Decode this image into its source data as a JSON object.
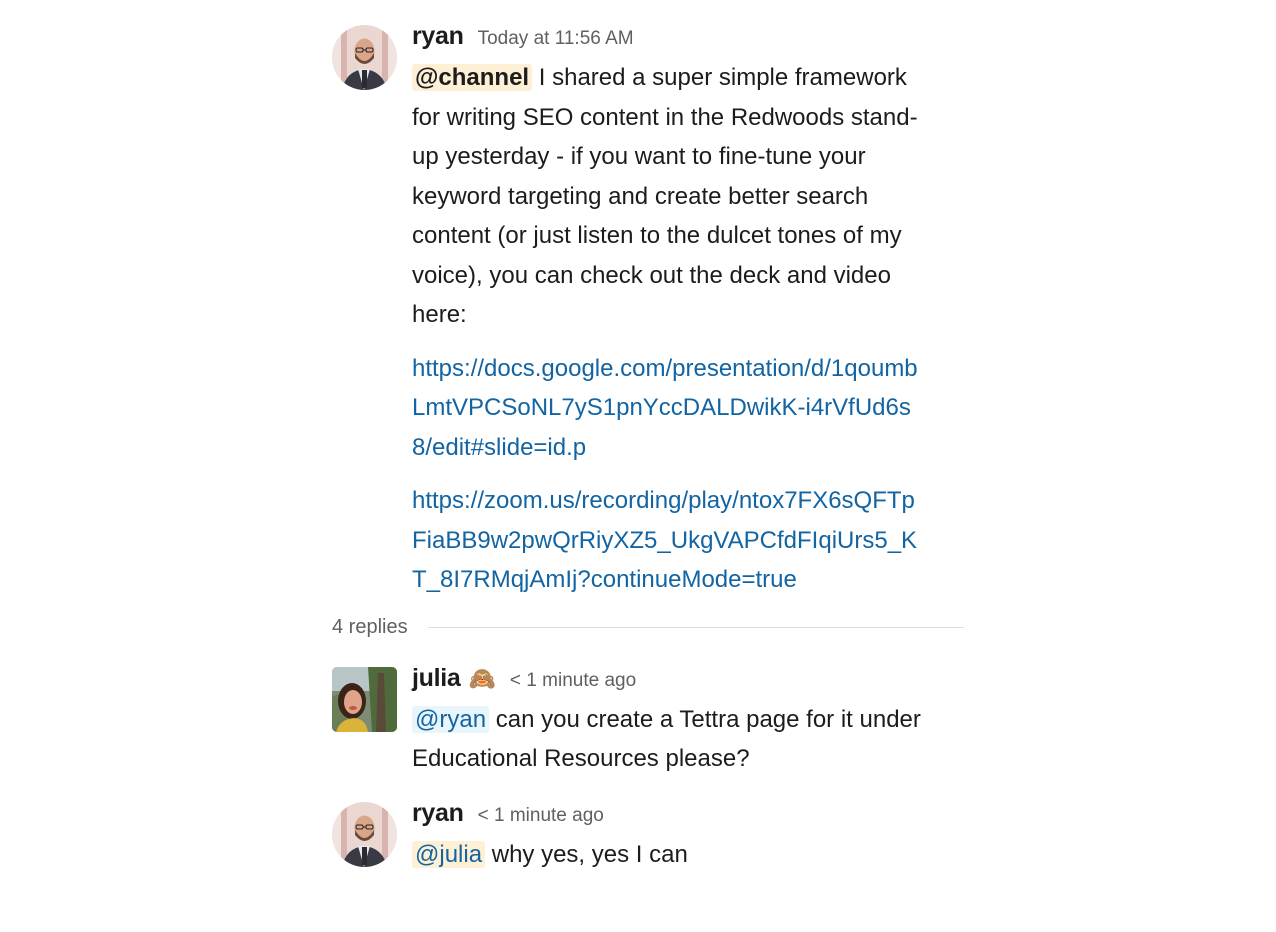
{
  "parent_message": {
    "author": "ryan",
    "timestamp": "Today at 11:56 AM",
    "mention": "@channel",
    "text": " I shared a super simple framework for writing SEO content in the Redwoods stand-up yesterday - if you want to fine-tune your keyword targeting and create better search content (or just listen to the dulcet tones of my voice), you can check out the deck and video here:",
    "links": [
      "https://docs.google.com/presentation/d/1qoumbLmtVPCSoNL7yS1pnYccDALDwikK-i4rVfUd6s8/edit#slide=id.p",
      "https://zoom.us/recording/play/ntox7FX6sQFTpFiaBB9w2pwQrRiyXZ5_UkgVAPCfdFIqiUrs5_KT_8I7RMqjAmIj?continueMode=true"
    ]
  },
  "replies_label": "4 replies",
  "replies": [
    {
      "author": "julia",
      "status_emoji": "🙈",
      "timestamp": "< 1 minute ago",
      "mention": "@ryan",
      "text": " can you create a Tettra page for it under Educational Resources please?"
    },
    {
      "author": "ryan",
      "timestamp": "< 1 minute ago",
      "mention": "@julia",
      "text": " why yes, yes I can"
    }
  ],
  "colors": {
    "link": "#1264a3",
    "channel_mention_bg": "#fdf0d5",
    "user_mention_bg": "#e8f5fa",
    "timestamp": "#616061"
  }
}
